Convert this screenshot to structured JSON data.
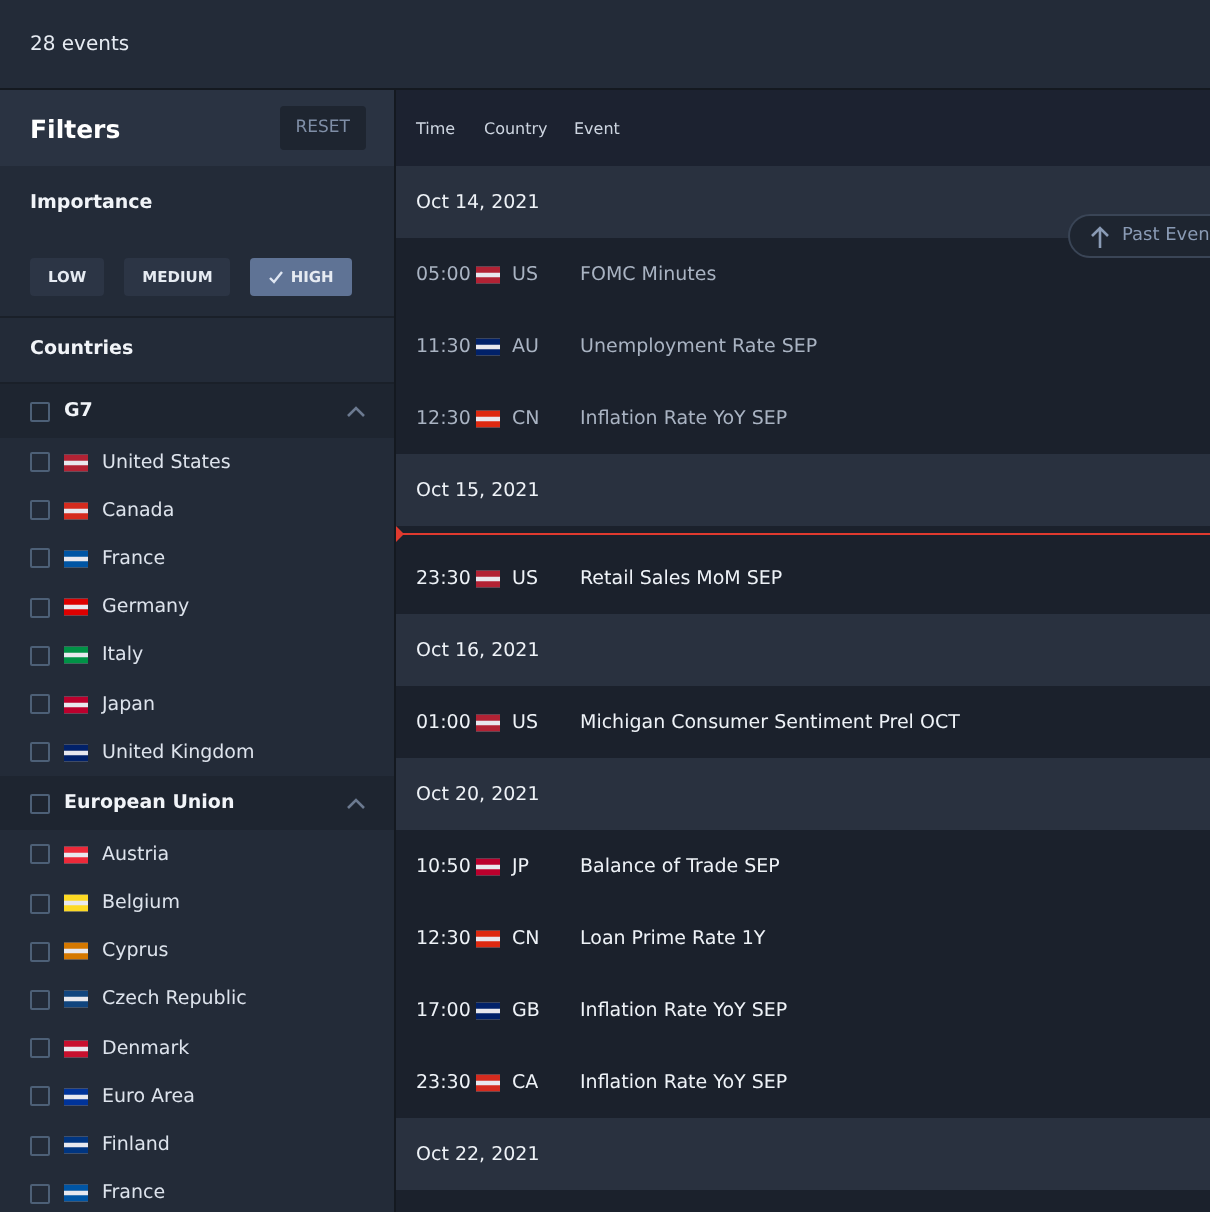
{
  "summary": "28 events",
  "filters": {
    "title": "Filters",
    "reset": "RESET",
    "importance": {
      "title": "Importance",
      "options": [
        {
          "label": "LOW",
          "selected": false
        },
        {
          "label": "MEDIUM",
          "selected": false
        },
        {
          "label": "HIGH",
          "selected": true
        }
      ]
    },
    "countries": {
      "title": "Countries",
      "groups": [
        {
          "name": "G7",
          "checked": false,
          "expanded": true,
          "items": [
            {
              "name": "United States",
              "checked": false,
              "color": "#b22234"
            },
            {
              "name": "Canada",
              "checked": false,
              "color": "#d52b1e"
            },
            {
              "name": "France",
              "checked": false,
              "color": "#0055a4"
            },
            {
              "name": "Germany",
              "checked": false,
              "color": "#dd0000"
            },
            {
              "name": "Italy",
              "checked": false,
              "color": "#009246"
            },
            {
              "name": "Japan",
              "checked": false,
              "color": "#bc002d"
            },
            {
              "name": "United Kingdom",
              "checked": false,
              "color": "#012169"
            }
          ]
        },
        {
          "name": "European Union",
          "checked": false,
          "expanded": true,
          "items": [
            {
              "name": "Austria",
              "checked": false,
              "color": "#ed2939"
            },
            {
              "name": "Belgium",
              "checked": false,
              "color": "#fdda24"
            },
            {
              "name": "Cyprus",
              "checked": false,
              "color": "#d57800"
            },
            {
              "name": "Czech Republic",
              "checked": false,
              "color": "#11457e"
            },
            {
              "name": "Denmark",
              "checked": false,
              "color": "#c8102e"
            },
            {
              "name": "Euro Area",
              "checked": false,
              "color": "#003399"
            },
            {
              "name": "Finland",
              "checked": false,
              "color": "#003580"
            },
            {
              "name": "France",
              "checked": false,
              "color": "#0055a4"
            }
          ]
        }
      ]
    }
  },
  "table": {
    "columns": [
      "Time",
      "Country",
      "Event"
    ],
    "past_events_button": "Past Even",
    "days": [
      {
        "date": "Oct 14, 2021",
        "events": [
          {
            "time": "05:00",
            "country": "US",
            "event": "FOMC Minutes",
            "past": true,
            "color": "#b22234"
          },
          {
            "time": "11:30",
            "country": "AU",
            "event": "Unemployment Rate SEP",
            "past": true,
            "color": "#012169"
          },
          {
            "time": "12:30",
            "country": "CN",
            "event": "Inflation Rate YoY SEP",
            "past": true,
            "color": "#de2910"
          }
        ]
      },
      {
        "date": "Oct 15, 2021",
        "events": [
          {
            "time": "23:30",
            "country": "US",
            "event": "Retail Sales MoM SEP",
            "past": false,
            "color": "#b22234"
          }
        ]
      },
      {
        "date": "Oct 16, 2021",
        "events": [
          {
            "time": "01:00",
            "country": "US",
            "event": "Michigan Consumer Sentiment Prel OCT",
            "past": false,
            "color": "#b22234"
          }
        ]
      },
      {
        "date": "Oct 20, 2021",
        "events": [
          {
            "time": "10:50",
            "country": "JP",
            "event": "Balance of Trade SEP",
            "past": false,
            "color": "#bc002d"
          },
          {
            "time": "12:30",
            "country": "CN",
            "event": "Loan Prime Rate 1Y",
            "past": false,
            "color": "#de2910"
          },
          {
            "time": "17:00",
            "country": "GB",
            "event": "Inflation Rate YoY SEP",
            "past": false,
            "color": "#012169"
          },
          {
            "time": "23:30",
            "country": "CA",
            "event": "Inflation Rate YoY SEP",
            "past": false,
            "color": "#d52b1e"
          }
        ]
      },
      {
        "date": "Oct 22, 2021"
      }
    ]
  }
}
